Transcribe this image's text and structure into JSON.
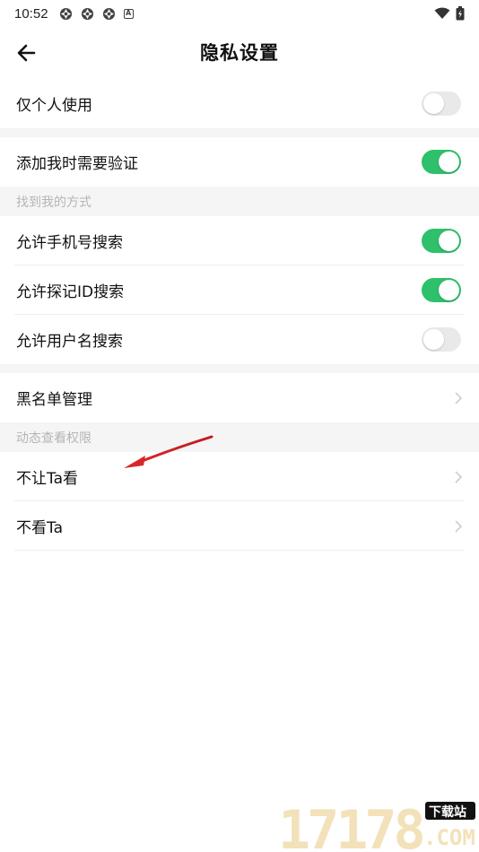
{
  "status_bar": {
    "time": "10:52",
    "notification_icons": [
      "app-icon",
      "app-icon",
      "app-icon",
      "a-icon"
    ],
    "notification_letter": "A"
  },
  "header": {
    "title": "隐私设置"
  },
  "rows": {
    "only_personal": {
      "label": "仅个人使用",
      "toggle": false
    },
    "need_verify": {
      "label": "添加我时需要验证",
      "toggle": true
    },
    "phone_search": {
      "label": "允许手机号搜索",
      "toggle": true
    },
    "id_search": {
      "label": "允许探记ID搜索",
      "toggle": true
    },
    "username_search": {
      "label": "允许用户名搜索",
      "toggle": false
    },
    "blacklist": {
      "label": "黑名单管理"
    },
    "hide_from": {
      "label": "不让Ta看"
    },
    "not_see": {
      "label": "不看Ta"
    }
  },
  "sections": {
    "find_me": "找到我的方式",
    "moments_permission": "动态查看权限"
  },
  "annotation": {
    "arrow_color": "#d9262a"
  },
  "watermark": {
    "text": "17178",
    "badge": "下载站",
    "suffix": ".COM"
  },
  "colors": {
    "toggle_on": "#2ec06a",
    "toggle_off": "#e9e9e9",
    "section_bg": "#f5f5f5",
    "section_text": "#b5b5b5"
  }
}
